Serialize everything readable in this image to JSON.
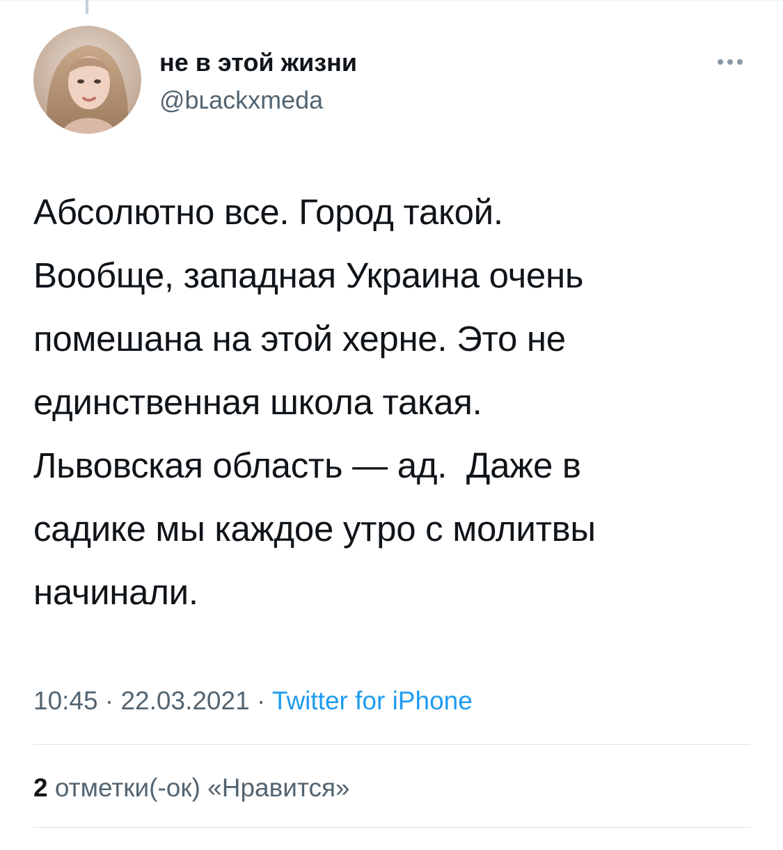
{
  "tweet": {
    "author": {
      "display_name": "не в этой жизни",
      "handle": "@bʟackxmeda"
    },
    "more_icon": "more-horizontal-icon",
    "text": "Абсолютно все. Город такой.\nВообще, западная Украина очень\nпомешана на этой херне. Это не\nединственная школа такая.\nЛьвовская область — ад.  Даже в\nсадике мы каждое утро с молитвы\nначинали.",
    "time": "10:45",
    "separator": " · ",
    "date": "22.03.2021",
    "source": "Twitter for iPhone",
    "likes": {
      "count": "2",
      "label": " отметки(-ок) «Нравится»"
    }
  },
  "colors": {
    "text_primary": "#0f1419",
    "text_secondary": "#536471",
    "link": "#1d9bf0",
    "divider": "#dfe4e8"
  }
}
